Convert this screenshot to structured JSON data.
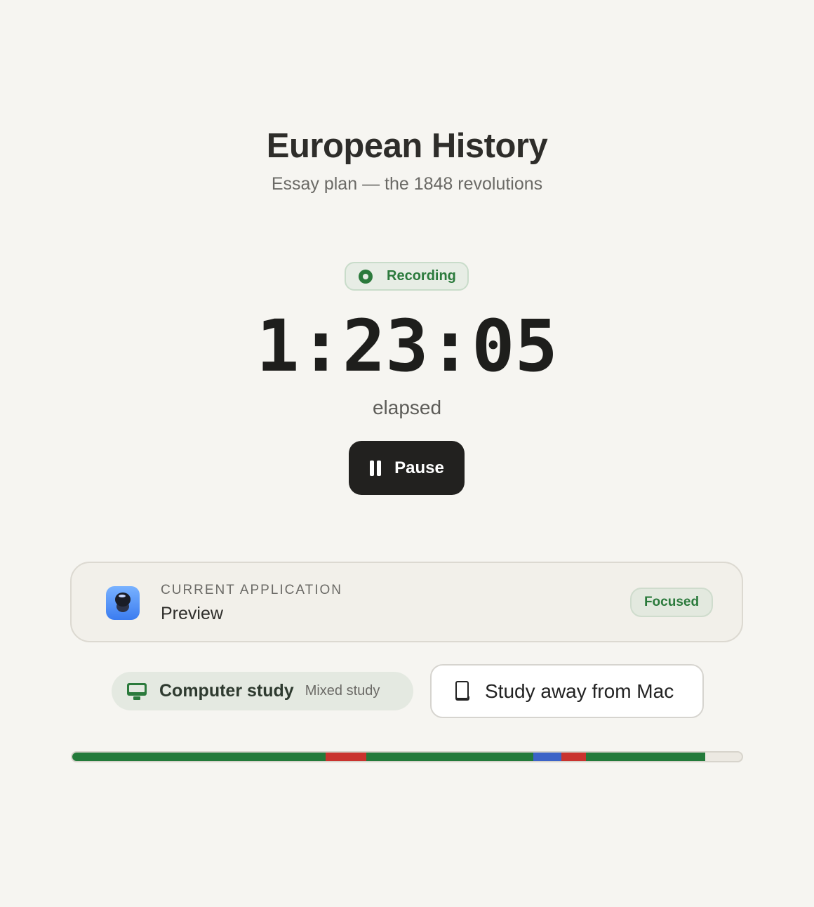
{
  "header": {
    "title": "European History",
    "subtitle": "Essay plan — the 1848 revolutions"
  },
  "session": {
    "status_label": "Recording",
    "timer": "1:23:05",
    "timer_caption": "elapsed",
    "pause_label": "Pause"
  },
  "current_app": {
    "heading": "CURRENT APPLICATION",
    "name": "Preview",
    "icon": "preview-app-icon",
    "status": "Focused"
  },
  "modes": {
    "computer": {
      "icon": "monitor-icon",
      "label": "Computer study",
      "sublabel": "Mixed study"
    },
    "away": {
      "icon": "book-icon",
      "label": "Study away from Mac"
    }
  },
  "timeline": {
    "fraction_elapsed": 0.946,
    "segments": [
      {
        "kind": "focused",
        "fraction": 0.378
      },
      {
        "kind": "distracted",
        "fraction": 0.061
      },
      {
        "kind": "focused",
        "fraction": 0.25
      },
      {
        "kind": "away",
        "fraction": 0.042
      },
      {
        "kind": "distracted",
        "fraction": 0.036
      },
      {
        "kind": "focused",
        "fraction": 0.179
      }
    ]
  },
  "colors": {
    "focused": "#237a3a",
    "distracted": "#c9332e",
    "away": "#3c63c7",
    "accent_green": "#2b7a3c",
    "background": "#f6f5f1"
  }
}
